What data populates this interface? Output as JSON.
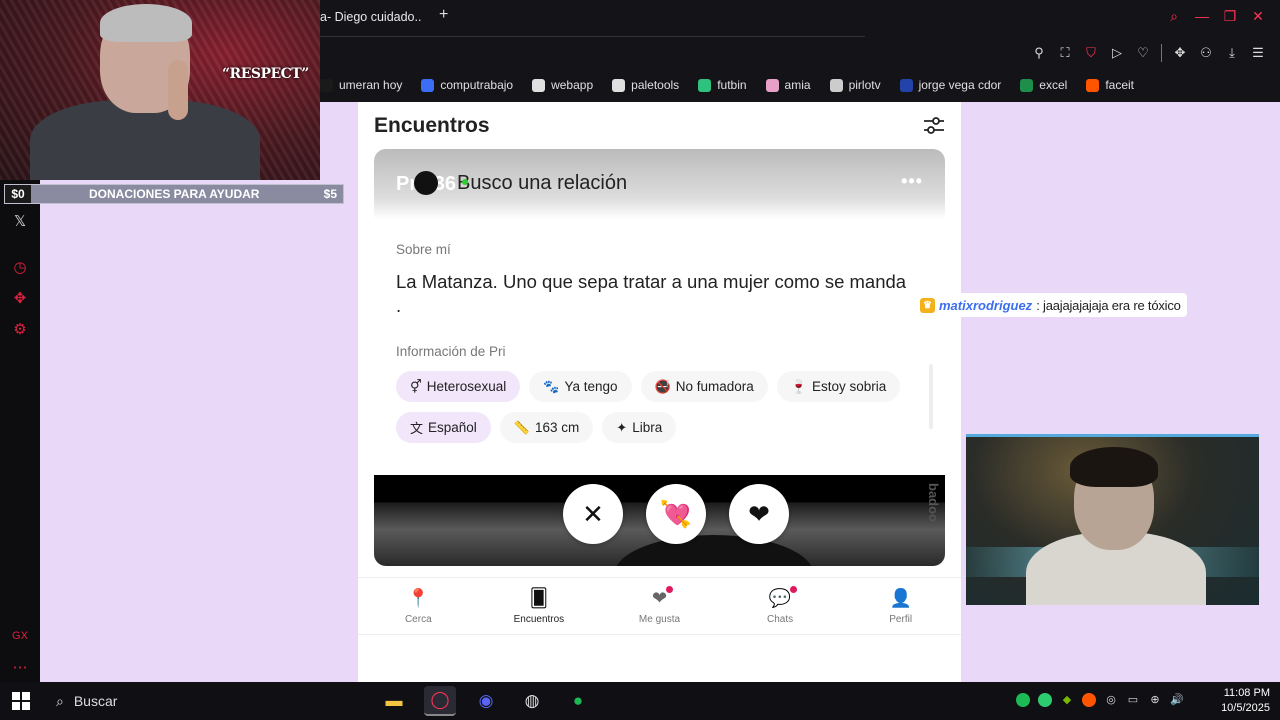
{
  "browser": {
    "tab_title": "a- Diego cuidado..",
    "bookmarks": [
      {
        "label": "umeran hoy",
        "color": "#1a1a1a"
      },
      {
        "label": "computrabajo",
        "color": "#3b6df5"
      },
      {
        "label": "webapp",
        "color": "#e0e0e0"
      },
      {
        "label": "paletools",
        "color": "#e0e0e0"
      },
      {
        "label": "futbin",
        "color": "#2ec27e"
      },
      {
        "label": "amia",
        "color": "#e8a0c8"
      },
      {
        "label": "pirlotv",
        "color": "#cccccc"
      },
      {
        "label": "jorge vega cdor",
        "color": "#2244aa"
      },
      {
        "label": "excel",
        "color": "#1e8f4a"
      },
      {
        "label": "faceit",
        "color": "#ff5500"
      }
    ]
  },
  "overlay": {
    "quote": "“RESPECT”",
    "donation_start": "$0",
    "donation_label": "DONACIONES PARA AYUDAR",
    "donation_goal": "$5"
  },
  "page": {
    "title": "Encuentros",
    "card": {
      "name": "Pri, 36",
      "status": "Busco una relación",
      "more": "•••",
      "about_label": "Sobre mí",
      "about_text": "La Matanza. Uno que sepa tratar a una mujer como se manda .",
      "info_label": "Información de Pri",
      "chips": [
        {
          "icon": "⚥",
          "label": "Heterosexual",
          "highlight": true
        },
        {
          "icon": "🐾",
          "label": "Ya tengo",
          "highlight": false
        },
        {
          "icon": "🚭",
          "label": "No fumadora",
          "highlight": false
        },
        {
          "icon": "🍷",
          "label": "Estoy sobria",
          "highlight": false
        },
        {
          "icon": "文",
          "label": "Español",
          "highlight": true
        },
        {
          "icon": "📏",
          "label": "163 cm",
          "highlight": false
        },
        {
          "icon": "✦",
          "label": "Libra",
          "highlight": false
        }
      ],
      "watermark": "badoo"
    },
    "nav": [
      {
        "icon": "📍",
        "label": "Cerca",
        "badge": false,
        "active": false
      },
      {
        "icon": "🂠",
        "label": "Encuentros",
        "badge": false,
        "active": true
      },
      {
        "icon": "❤",
        "label": "Me gusta",
        "badge": true,
        "active": false
      },
      {
        "icon": "💬",
        "label": "Chats",
        "badge": true,
        "active": false
      },
      {
        "icon": "👤",
        "label": "Perfil",
        "badge": false,
        "active": false
      }
    ]
  },
  "chat": {
    "user": "matixrodriguez",
    "message": ": jaajajajajaja era re tóxico"
  },
  "taskbar": {
    "search_placeholder": "Buscar",
    "time": "11:08 PM",
    "date": "10/5/2025"
  },
  "colors": {
    "accent": "#ff3355",
    "background": "#e9d8f8",
    "badge": "#e0195a",
    "chip_highlight": "#f1e6fa"
  }
}
